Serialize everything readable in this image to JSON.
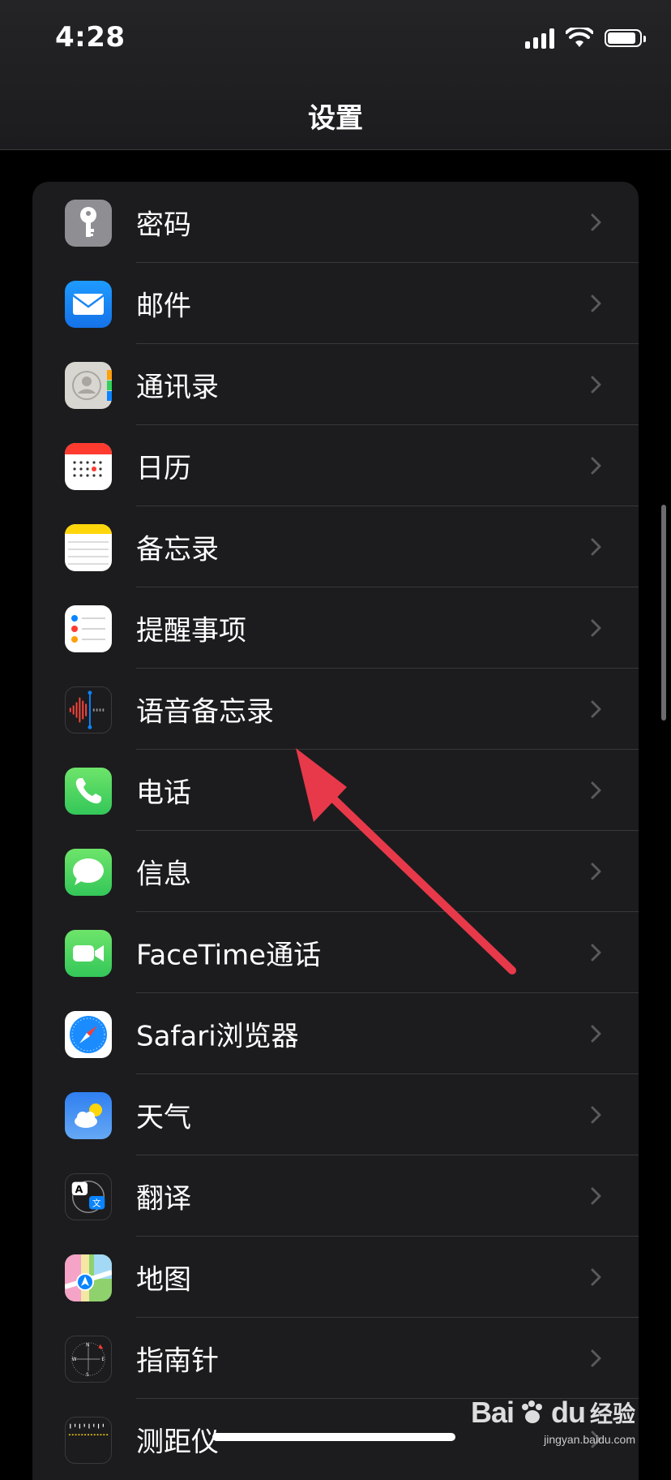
{
  "status_bar": {
    "time": "4:28",
    "battery_level": 0.9
  },
  "nav": {
    "title": "设置"
  },
  "settings": {
    "items": [
      {
        "label": "密码",
        "icon": "key-icon"
      },
      {
        "label": "邮件",
        "icon": "mail-icon"
      },
      {
        "label": "通讯录",
        "icon": "contacts-icon"
      },
      {
        "label": "日历",
        "icon": "calendar-icon"
      },
      {
        "label": "备忘录",
        "icon": "notes-icon"
      },
      {
        "label": "提醒事项",
        "icon": "reminders-icon"
      },
      {
        "label": "语音备忘录",
        "icon": "voice-memos-icon"
      },
      {
        "label": "电话",
        "icon": "phone-icon"
      },
      {
        "label": "信息",
        "icon": "messages-icon"
      },
      {
        "label": "FaceTime通话",
        "icon": "facetime-icon"
      },
      {
        "label": "Safari浏览器",
        "icon": "safari-icon"
      },
      {
        "label": "天气",
        "icon": "weather-icon"
      },
      {
        "label": "翻译",
        "icon": "translate-icon"
      },
      {
        "label": "地图",
        "icon": "maps-icon"
      },
      {
        "label": "指南针",
        "icon": "compass-icon"
      },
      {
        "label": "测距仪",
        "icon": "measure-icon"
      }
    ]
  },
  "watermark": {
    "brand": "Bai",
    "brand2": "du",
    "text": "经验",
    "url": "jingyan.baidu.com"
  },
  "colors": {
    "background": "#000000",
    "group": "#1c1c1e",
    "separator": "#38383a",
    "chevron": "#5a5a5e",
    "annotation_arrow": "#e8394a"
  }
}
